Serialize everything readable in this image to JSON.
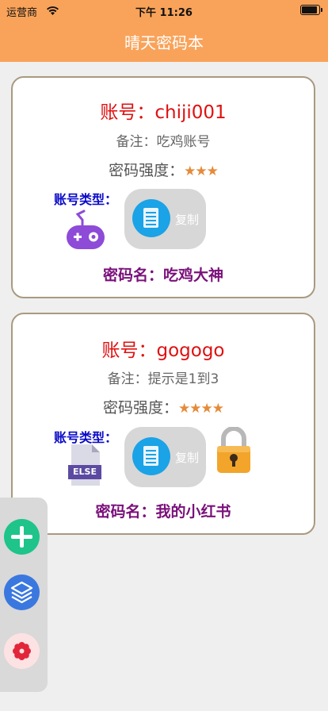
{
  "status_bar": {
    "carrier": "运营商",
    "time": "下午 11:26"
  },
  "nav": {
    "title": "晴天密码本"
  },
  "cards": [
    {
      "account": "账号：chiji001",
      "note": "备注：吃鸡账号",
      "strength_label": "密码强度：",
      "stars": "★★★",
      "account_type_label": "账号类型：",
      "account_type_icon": "gamepad-icon",
      "copy_label": "复制",
      "password_name": "密码名：吃鸡大神"
    },
    {
      "account": "账号：gogogo",
      "note": "备注：提示是1到3",
      "strength_label": "密码强度：",
      "stars": "★★★★",
      "account_type_label": "账号类型：",
      "account_type_icon": "else-file-icon",
      "else_text": "ELSE",
      "copy_label": "复制",
      "lock_icon": "padlock-icon",
      "password_name": "密码名：我的小红书"
    }
  ],
  "fab_panel": {
    "add_icon": "plus-icon",
    "layers_icon": "layers-icon",
    "settings_icon": "flower-gear-icon"
  },
  "colors": {
    "header": "#f9a35a",
    "account_text": "#e01010",
    "type_label": "#0a0ac8",
    "password_name": "#7a107a",
    "star": "#e48b3a",
    "add_fab": "#1ec48a",
    "layers_fab": "#3a78e0",
    "settings_fab": "#fde2e4"
  }
}
